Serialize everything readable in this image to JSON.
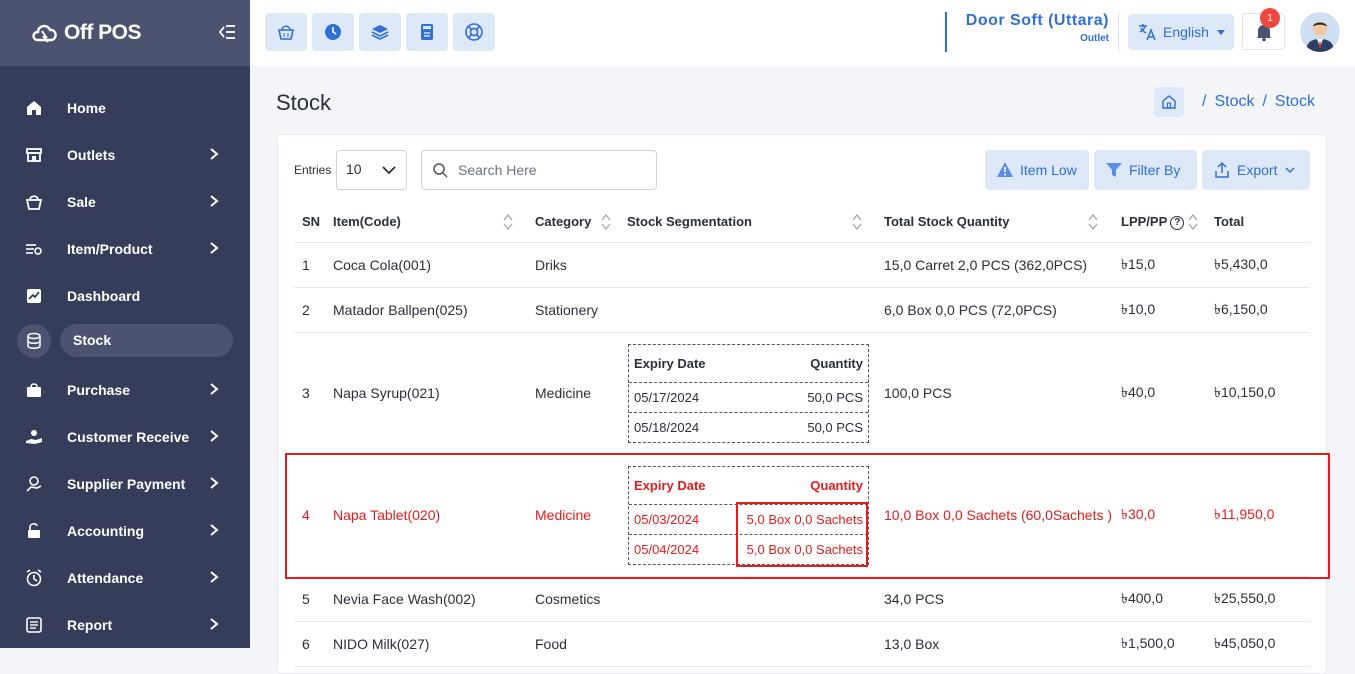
{
  "app": {
    "name": "Off POS"
  },
  "sidebar": {
    "items": [
      {
        "label": "Home"
      },
      {
        "label": "Outlets"
      },
      {
        "label": "Sale"
      },
      {
        "label": "Item/Product"
      },
      {
        "label": "Dashboard"
      },
      {
        "label": "Stock"
      },
      {
        "label": "Purchase"
      },
      {
        "label": "Customer Receive"
      },
      {
        "label": "Supplier Payment"
      },
      {
        "label": "Accounting"
      },
      {
        "label": "Attendance"
      },
      {
        "label": "Report"
      }
    ]
  },
  "header": {
    "outlet_name": "Door Soft (Uttara)",
    "outlet_sub": "Outlet",
    "language": "English",
    "notification_count": "1"
  },
  "page": {
    "title": "Stock",
    "breadcrumb": [
      "Stock",
      "Stock"
    ]
  },
  "toolbar": {
    "entries_label": "Entries",
    "entries_value": "10",
    "search_placeholder": "Search Here",
    "item_low": "Item Low",
    "filter_by": "Filter By",
    "export": "Export"
  },
  "table": {
    "headers": [
      "SN",
      "Item(Code)",
      "Category",
      "Stock Segmentation",
      "Total Stock Quantity",
      "LPP/PP",
      "Total"
    ],
    "seg_headers": [
      "Expiry Date",
      "Quantity"
    ],
    "rows": [
      {
        "sn": "1",
        "item": "Coca Cola(001)",
        "category": "Driks",
        "total_qty": "15,0 Carret 2,0 PCS (362,0PCS)",
        "lpp": "৳15,0",
        "total": "৳5,430,0"
      },
      {
        "sn": "2",
        "item": "Matador Ballpen(025)",
        "category": "Stationery",
        "total_qty": "6,0 Box 0,0 PCS (72,0PCS)",
        "lpp": "৳10,0",
        "total": "৳6,150,0"
      },
      {
        "sn": "3",
        "item": "Napa Syrup(021)",
        "category": "Medicine",
        "total_qty": "100,0 PCS",
        "lpp": "৳40,0",
        "total": "৳10,150,0",
        "segments": [
          {
            "date": "05/17/2024",
            "qty": "50,0 PCS"
          },
          {
            "date": "05/18/2024",
            "qty": "50,0 PCS"
          }
        ]
      },
      {
        "sn": "4",
        "item": "Napa Tablet(020)",
        "category": "Medicine",
        "total_qty": "10,0 Box 0,0 Sachets (60,0Sachets )",
        "lpp": "৳30,0",
        "total": "৳11,950,0",
        "segments": [
          {
            "date": "05/03/2024",
            "qty": "5,0 Box 0,0 Sachets"
          },
          {
            "date": "05/04/2024",
            "qty": "5,0 Box 0,0 Sachets"
          }
        ]
      },
      {
        "sn": "5",
        "item": "Nevia Face Wash(002)",
        "category": "Cosmetics",
        "total_qty": "34,0 PCS",
        "lpp": "৳400,0",
        "total": "৳25,550,0"
      },
      {
        "sn": "6",
        "item": "NIDO Milk(027)",
        "category": "Food",
        "total_qty": "13,0 Box",
        "lpp": "৳1,500,0",
        "total": "৳45,050,0"
      }
    ]
  },
  "colors": {
    "sidebar": "#353d5a",
    "accent": "#2f6fd6",
    "highlight": "#e11d1d"
  }
}
